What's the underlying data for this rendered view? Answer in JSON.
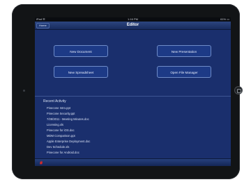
{
  "status": {
    "left": "iPad ☰",
    "time": "1:16 PM",
    "right": "61% ▭"
  },
  "nav": {
    "back_label": "Home",
    "title": "Editor"
  },
  "buttons": {
    "new_document": "New Document",
    "new_presentation": "New Presentation",
    "new_spreadsheet": "New Spreadsheet",
    "open_file_manager": "Open File Manager"
  },
  "recent": {
    "title": "Recent Activity",
    "items": [
      "Pinecone Intro.ppt",
      "Pinecone Security.ppt",
      "7/28/2011 - Meeting Minutes.doc",
      "Licensing.xls",
      "Pinecone for iOS.doc",
      "MDM Comparison.ppt",
      "Apple Enterprise Deployment.doc",
      "Dev Schedule.xls",
      "Pinecone for Android.doc"
    ]
  },
  "icons": {
    "bottom_left": "red-hand-icon",
    "home": "home-button-icon"
  },
  "colors": {
    "screen_bg": "#1a2f6d",
    "button_border": "#6f8cc8",
    "accent_red": "#d22a2a"
  }
}
